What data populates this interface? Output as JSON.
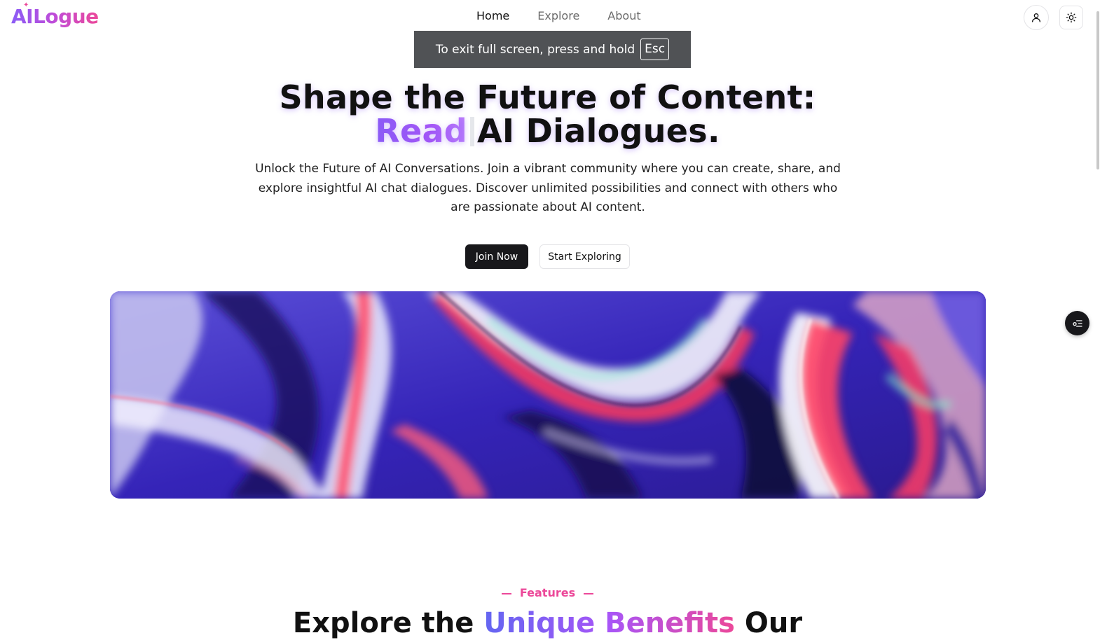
{
  "header": {
    "logo": "AILogue",
    "nav": [
      {
        "label": "Home",
        "active": true
      },
      {
        "label": "Explore",
        "active": false
      },
      {
        "label": "About",
        "active": false
      }
    ],
    "user_icon": "user-icon",
    "theme_icon": "sun-icon"
  },
  "fullscreen_notice": {
    "text": "To exit full screen, press and hold",
    "key": "Esc"
  },
  "hero": {
    "title_line1": "Shape the Future of Content:",
    "title_word": "Read",
    "title_rest": "AI Dialogues.",
    "subtitle": "Unlock the Future of AI Conversations. Join a vibrant community where you can create, share, and explore insightful AI chat dialogues. Discover unlimited possibilities and connect with others who are passionate about AI content.",
    "join_button": "Join Now",
    "explore_button": "Start Exploring"
  },
  "features": {
    "tag": "Features",
    "title_start": "Explore the",
    "title_highlight": "Unique Benefits",
    "title_end": "Our"
  },
  "colors": {
    "brand_purple": "#8b5cf6",
    "brand_pink": "#ec4899",
    "dark_button": "#18181b"
  }
}
